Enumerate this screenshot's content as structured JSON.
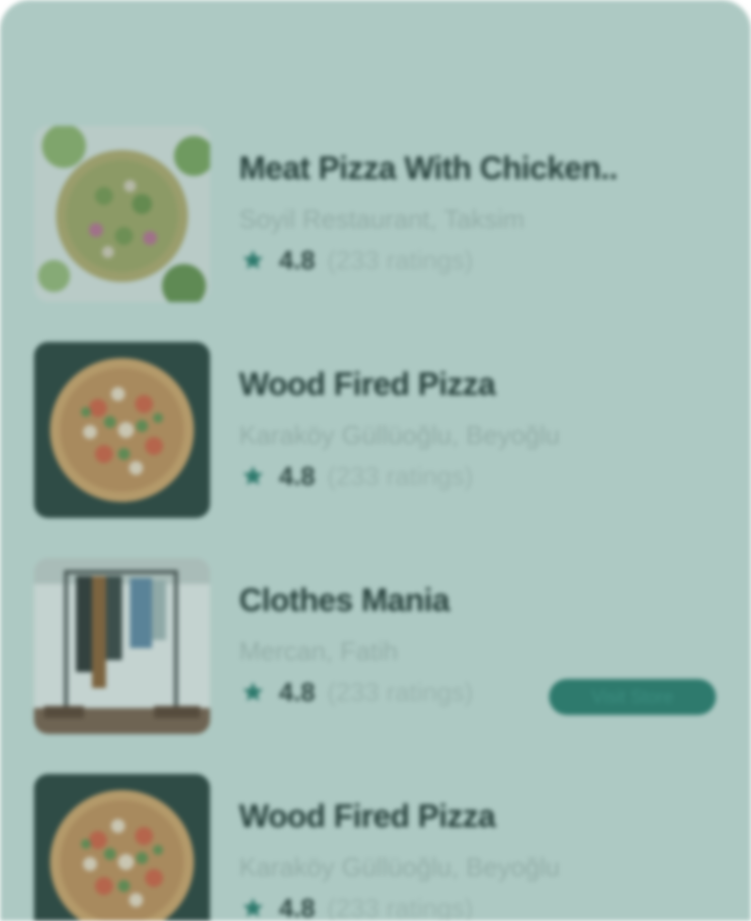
{
  "colors": {
    "background": "#adc9c3",
    "accent": "#2e7a6d",
    "title": "#28423d",
    "subtitle": "#93aea8"
  },
  "items": [
    {
      "title": "Meat Pizza With Chicken..",
      "subtitle": "Soyil Restaurant, Taksim",
      "rating": "4.8",
      "ratings_count": "(233 ratings)",
      "image": "pizza-with-greens-photo"
    },
    {
      "title": "Wood Fired Pizza",
      "subtitle": "Karaköy Güllüoğlu, Beyoğlu",
      "rating": "4.8",
      "ratings_count": "(233 ratings)",
      "image": "wood-fired-pizza-photo"
    },
    {
      "title": "Clothes Mania",
      "subtitle": "Mercan, Fatih",
      "rating": "4.8",
      "ratings_count": "(233 ratings)",
      "image": "clothes-rack-photo",
      "action_label": "Visit Store"
    },
    {
      "title": "Wood Fired Pizza",
      "subtitle": "Karaköy Güllüoğlu, Beyoğlu",
      "rating": "4.8",
      "ratings_count": "(233 ratings)",
      "image": "wood-fired-pizza-photo"
    }
  ]
}
